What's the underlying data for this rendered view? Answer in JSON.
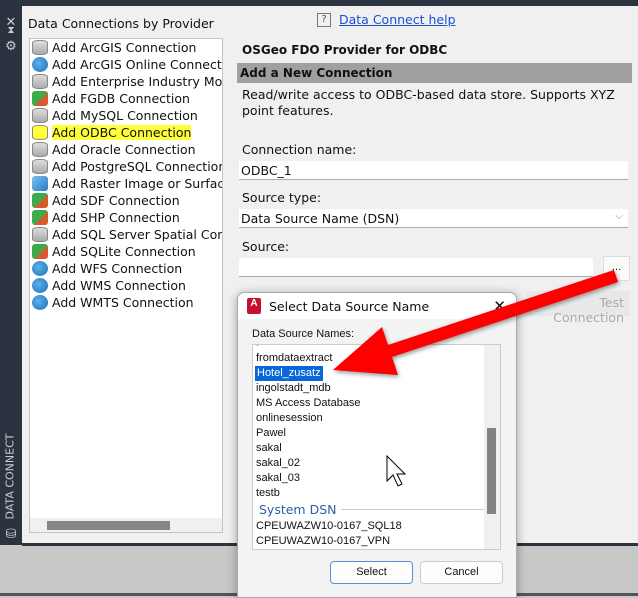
{
  "sidebar": {
    "vertical_label": "DATA CONNECT",
    "icons": [
      "close-icon",
      "pin-icon",
      "gear-icon",
      "database-icon"
    ]
  },
  "providers": {
    "heading": "Data Connections by Provider",
    "items": [
      {
        "label": "Add ArcGIS Connection",
        "icon": "db"
      },
      {
        "label": "Add ArcGIS Online Connection",
        "icon": "globe"
      },
      {
        "label": "Add Enterprise Industry Model C",
        "icon": "db"
      },
      {
        "label": "Add FGDB Connection",
        "icon": "grid"
      },
      {
        "label": "Add MySQL Connection",
        "icon": "db"
      },
      {
        "label": "Add ODBC Connection",
        "icon": "db",
        "highlight": true
      },
      {
        "label": "Add Oracle Connection",
        "icon": "db"
      },
      {
        "label": "Add PostgreSQL Connection",
        "icon": "db"
      },
      {
        "label": "Add Raster Image or Surface Cor",
        "icon": "img"
      },
      {
        "label": "Add SDF Connection",
        "icon": "grid"
      },
      {
        "label": "Add SHP Connection",
        "icon": "grid"
      },
      {
        "label": "Add SQL Server Spatial Connecti",
        "icon": "db"
      },
      {
        "label": "Add SQLite Connection",
        "icon": "grid"
      },
      {
        "label": "Add WFS Connection",
        "icon": "globe"
      },
      {
        "label": "Add WMS Connection",
        "icon": "globe"
      },
      {
        "label": "Add WMTS Connection",
        "icon": "globe"
      }
    ]
  },
  "details": {
    "help_icon": "?",
    "help_link": "Data Connect help",
    "provider_title": "OSGeo FDO Provider for ODBC",
    "section": "Add a New Connection",
    "description": "Read/write access to ODBC-based data store. Supports XYZ point features.",
    "connection_name_label": "Connection name:",
    "connection_name_value": "ODBC_1",
    "source_type_label": "Source type:",
    "source_type_value": "Data Source Name (DSN)",
    "source_label": "Source:",
    "source_value": "",
    "browse_label": "...",
    "test_connection": "Test Connection"
  },
  "dialog": {
    "logo": "A",
    "title": "Select Data Source Name",
    "close": "✕",
    "list_label": "Data Source Names:",
    "user_dsn": [
      "fromdataextract",
      "Hotel_zusatz",
      "ingolstadt_mdb",
      "MS Access Database",
      "onlinesession",
      "Pawel",
      "sakal",
      "sakal_02",
      "sakal_03",
      "testb"
    ],
    "selected": "Hotel_zusatz",
    "system_group": "System DSN",
    "system_dsn": [
      "CPEUWAZW10-0167_SQL18",
      "CPEUWAZW10-0167_VPN"
    ],
    "select_button": "Select",
    "cancel_button": "Cancel"
  },
  "annotation": {
    "arrow_color": "#ff0000"
  }
}
